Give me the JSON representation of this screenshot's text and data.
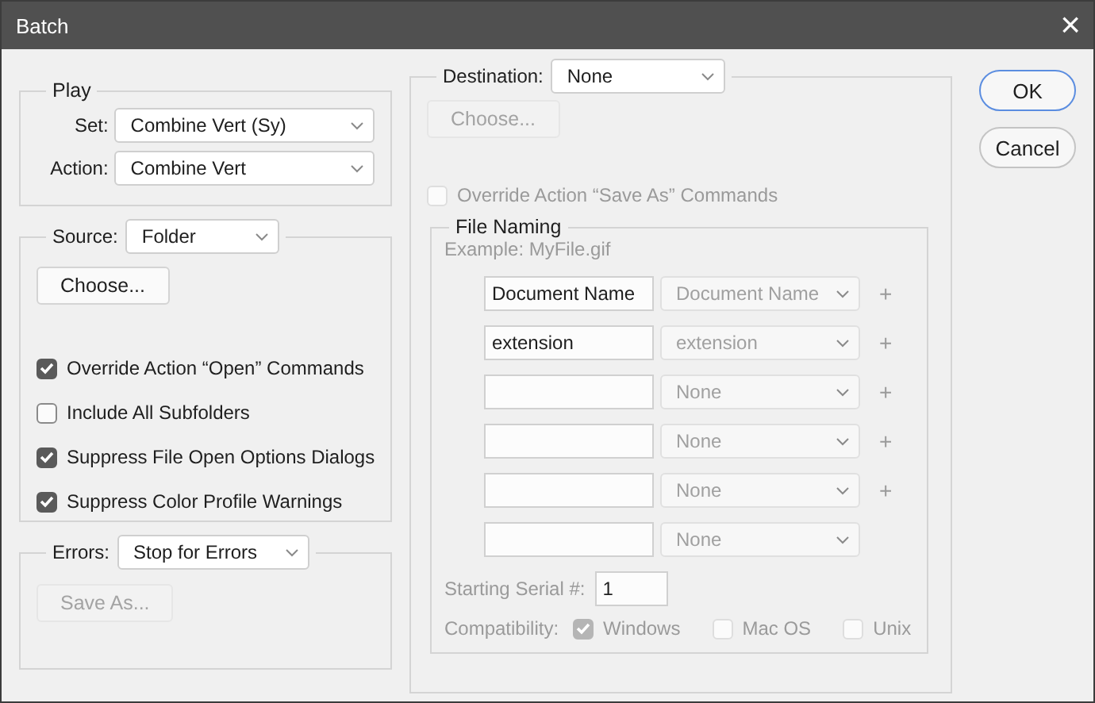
{
  "window": {
    "title": "Batch",
    "close": "×"
  },
  "play": {
    "legend": "Play",
    "rows": [
      {
        "label": "Set:",
        "value": "Combine Vert (Sy)"
      },
      {
        "label": "Action:",
        "value": "Combine Vert"
      }
    ]
  },
  "source": {
    "label": "Source:",
    "value": "Folder",
    "choose": {
      "label": "Choose...",
      "disabled": false
    },
    "options": [
      {
        "label": "Override Action “Open” Commands",
        "checked": true,
        "disabled": false
      },
      {
        "label": "Include All Subfolders",
        "checked": false,
        "disabled": false
      },
      {
        "label": "Suppress File Open Options Dialogs",
        "checked": true,
        "disabled": false
      },
      {
        "label": "Suppress Color Profile Warnings",
        "checked": true,
        "disabled": false
      }
    ]
  },
  "errors": {
    "label": "Errors:",
    "value": "Stop for Errors",
    "save_as": {
      "label": "Save As...",
      "disabled": true
    }
  },
  "destination": {
    "label": "Destination:",
    "value": "None",
    "choose": {
      "label": "Choose...",
      "disabled": true
    },
    "override": {
      "label": "Override Action “Save As” Commands",
      "checked": false,
      "disabled": true
    },
    "file_naming": {
      "legend": "File Naming",
      "example": "Example: MyFile.gif",
      "rows": [
        {
          "text": "Document Name",
          "token": "Document Name",
          "plus": "+"
        },
        {
          "text": "extension",
          "token": "extension",
          "plus": "+"
        },
        {
          "text": "",
          "token": "None",
          "plus": "+"
        },
        {
          "text": "",
          "token": "None",
          "plus": "+"
        },
        {
          "text": "",
          "token": "None",
          "plus": "+"
        },
        {
          "text": "",
          "token": "None"
        }
      ],
      "serial_label": "Starting Serial #:",
      "serial": "1",
      "compat_label": "Compatibility:",
      "compat": [
        {
          "label": "Windows",
          "checked": true,
          "disabled": true
        },
        {
          "label": "Mac OS",
          "checked": false,
          "disabled": true
        },
        {
          "label": "Unix",
          "checked": false,
          "disabled": true
        }
      ]
    }
  },
  "buttons": [
    {
      "label": "OK",
      "default": true
    },
    {
      "label": "Cancel",
      "default": false
    }
  ]
}
